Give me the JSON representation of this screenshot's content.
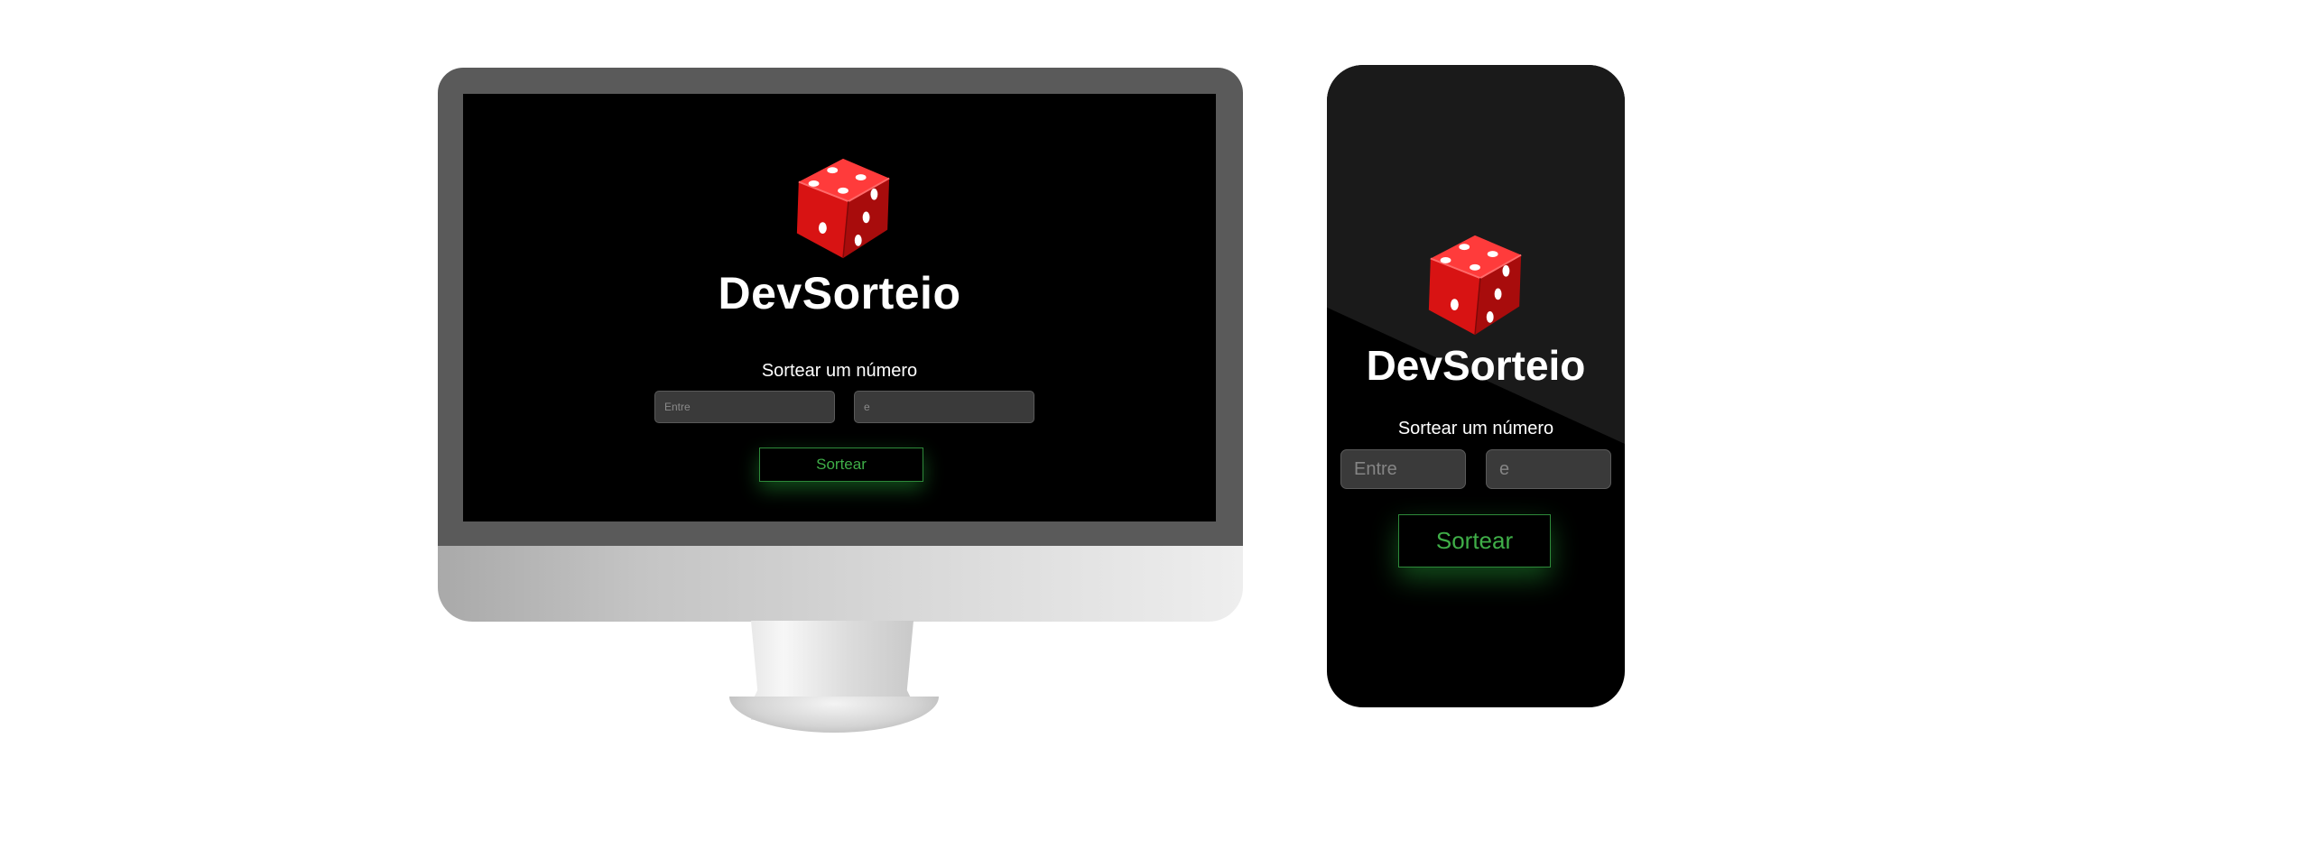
{
  "desktop": {
    "title": "DevSorteio",
    "subtitle": "Sortear um número",
    "min_placeholder": "Entre",
    "max_placeholder": "e",
    "button_label": "Sortear"
  },
  "mobile": {
    "title": "DevSorteio",
    "subtitle": "Sortear um número",
    "min_placeholder": "Entre",
    "max_placeholder": "e",
    "button_label": "Sortear"
  },
  "logo_icon": "red-dice-icon",
  "colors": {
    "screen_background": "#000000",
    "accent_green": "#3fae48",
    "input_background": "#3a3a3a",
    "die_red": "#e01515"
  }
}
